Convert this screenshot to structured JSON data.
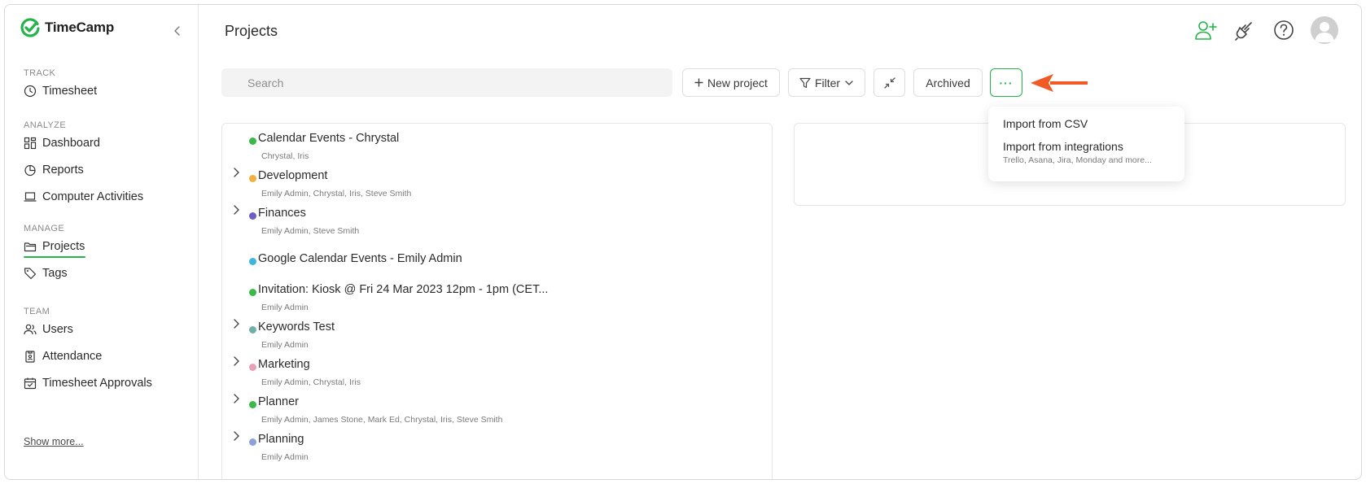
{
  "app": {
    "name": "TimeCamp",
    "brand_color": "#25b34b"
  },
  "sidebar": {
    "sections": [
      {
        "heading": "TRACK",
        "items": [
          {
            "label": "Timesheet",
            "icon": "clock-icon"
          }
        ]
      },
      {
        "heading": "ANALYZE",
        "items": [
          {
            "label": "Dashboard",
            "icon": "dashboard-icon"
          },
          {
            "label": "Reports",
            "icon": "pie-chart-icon"
          },
          {
            "label": "Computer Activities",
            "icon": "laptop-icon"
          }
        ]
      },
      {
        "heading": "MANAGE",
        "items": [
          {
            "label": "Projects",
            "icon": "folder-icon",
            "active": true
          },
          {
            "label": "Tags",
            "icon": "tag-icon"
          }
        ]
      },
      {
        "heading": "TEAM",
        "items": [
          {
            "label": "Users",
            "icon": "users-icon"
          },
          {
            "label": "Attendance",
            "icon": "badge-icon"
          },
          {
            "label": "Timesheet Approvals",
            "icon": "calendar-check-icon"
          }
        ]
      }
    ],
    "show_more": "Show more..."
  },
  "header": {
    "title": "Projects"
  },
  "toolbar": {
    "search_placeholder": "Search",
    "new_project": "New project",
    "filter": "Filter",
    "archived": "Archived",
    "more": "···"
  },
  "dropdown": {
    "items": [
      {
        "title": "Import from CSV",
        "subtitle": ""
      },
      {
        "title": "Import from integrations",
        "subtitle": "Trello, Asana, Jira, Monday and more..."
      }
    ]
  },
  "projects": [
    {
      "name": "Calendar Events - Chrystal",
      "members": "Chrystal, Iris",
      "color": "#3cb84a",
      "expandable": false
    },
    {
      "name": "Development",
      "members": "Emily Admin, Chrystal, Iris, Steve Smith",
      "color": "#f2b13f",
      "expandable": true
    },
    {
      "name": "Finances",
      "members": "Emily Admin, Steve Smith",
      "color": "#6a5fbf",
      "expandable": true
    },
    {
      "name": "Google Calendar Events - Emily Admin",
      "members": "",
      "color": "#3fb4dd",
      "expandable": false
    },
    {
      "name": "Invitation: Kiosk @ Fri 24 Mar 2023 12pm - 1pm (CET...",
      "members": "Emily Admin",
      "color": "#3cb84a",
      "expandable": false
    },
    {
      "name": "Keywords Test",
      "members": "Emily Admin",
      "color": "#6fb0a8",
      "expandable": true
    },
    {
      "name": "Marketing",
      "members": "Emily Admin, Chrystal, Iris",
      "color": "#e7a0b6",
      "expandable": true
    },
    {
      "name": "Planner",
      "members": "Emily Admin, James Stone, Mark Ed, Chrystal, Iris, Steve Smith",
      "color": "#3cb84a",
      "expandable": true
    },
    {
      "name": "Planning",
      "members": "Emily Admin",
      "color": "#8fa0d8",
      "expandable": true
    }
  ]
}
